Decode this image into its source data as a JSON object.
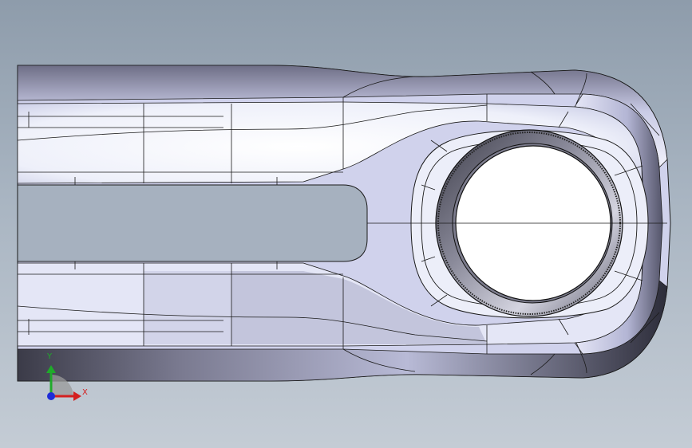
{
  "viewport": {
    "background_top": "#8e9cab",
    "background_bottom": "#c4ccd5"
  },
  "model": {
    "name": "",
    "body_color": "#d9dcf0",
    "shade_color": "#5a5a70",
    "edge_color": "#1a1a1a"
  },
  "triad": {
    "y_axis_label": "Y",
    "x_axis_label": "X",
    "y_color": "#1faa2a",
    "x_color": "#d42020",
    "origin_color": "#1e2cd8",
    "icon": "coordinate-triad-icon"
  }
}
